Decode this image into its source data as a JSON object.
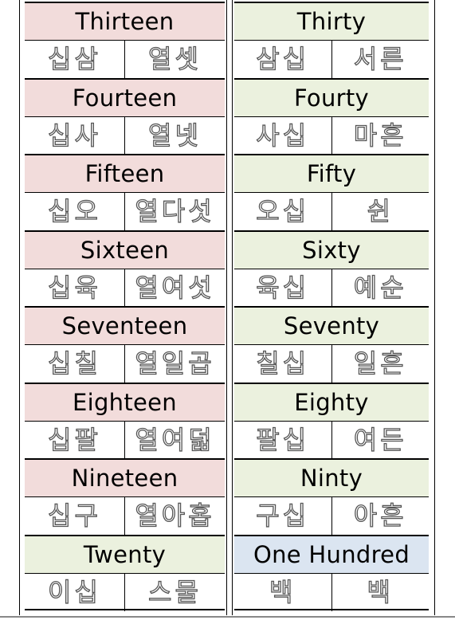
{
  "left_column": [
    {
      "title": "Thirteen",
      "color": "#f2dcdb",
      "sino": "십삼",
      "native": "열셋"
    },
    {
      "title": "Fourteen",
      "color": "#f2dcdb",
      "sino": "십사",
      "native": "열넷"
    },
    {
      "title": "Fifteen",
      "color": "#f2dcdb",
      "sino": "십오",
      "native": "열다섯"
    },
    {
      "title": "Sixteen",
      "color": "#f2dcdb",
      "sino": "십육",
      "native": "열여섯"
    },
    {
      "title": "Seventeen",
      "color": "#f2dcdb",
      "sino": "십칠",
      "native": "열일곱"
    },
    {
      "title": "Eighteen",
      "color": "#f2dcdb",
      "sino": "십팔",
      "native": "열여덟"
    },
    {
      "title": "Nineteen",
      "color": "#f2dcdb",
      "sino": "십구",
      "native": "열아홉"
    },
    {
      "title": "Twenty",
      "color": "#ebf1de",
      "sino": "이십",
      "native": "스물"
    }
  ],
  "right_column": [
    {
      "title": "Thirty",
      "color": "#ebf1de",
      "sino": "삼십",
      "native": "서른"
    },
    {
      "title": "Fourty",
      "color": "#ebf1de",
      "sino": "사십",
      "native": "마흔"
    },
    {
      "title": "Fifty",
      "color": "#ebf1de",
      "sino": "오십",
      "native": "쉰"
    },
    {
      "title": "Sixty",
      "color": "#ebf1de",
      "sino": "육십",
      "native": "예순"
    },
    {
      "title": "Seventy",
      "color": "#ebf1de",
      "sino": "칠십",
      "native": "일흔"
    },
    {
      "title": "Eighty",
      "color": "#ebf1de",
      "sino": "팔십",
      "native": "여든"
    },
    {
      "title": "Ninty",
      "color": "#ebf1de",
      "sino": "구십",
      "native": "아흔"
    },
    {
      "title": "One Hundred",
      "color": "#dbe5f1",
      "sino": "백",
      "native": "백"
    }
  ]
}
